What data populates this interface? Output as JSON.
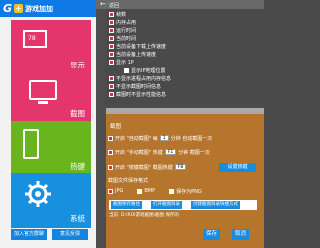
{
  "app": {
    "logo_letter": "G",
    "logo_plus": "+",
    "title": "游戏加加"
  },
  "tiles": [
    {
      "label": "显示",
      "icon": "display-icon",
      "icon_text": "78"
    },
    {
      "label": "截图",
      "icon": "monitor-icon"
    },
    {
      "label": "热键",
      "icon": "keyboard-icon"
    },
    {
      "label": "系统",
      "icon": "gear-icon"
    }
  ],
  "left_buttons": {
    "qq": "加入官方群聊",
    "feedback": "意见反馈"
  },
  "header": {
    "back_glyph": "←",
    "back_label": "返回"
  },
  "display_options": [
    {
      "label": "帧数",
      "checked": true
    },
    {
      "label": "内存占用",
      "checked": true
    },
    {
      "label": "运行时间",
      "checked": true
    },
    {
      "label": "当前时间",
      "checked": true
    },
    {
      "label": "当前设备下载上传速度",
      "checked": true
    },
    {
      "label": "当前设备上传速度",
      "checked": true
    },
    {
      "label": "显示 1P",
      "checked": true
    },
    {
      "label": "显示IP地理位置",
      "checked": false
    },
    {
      "label": "不显示进程占用内存信息",
      "checked": true
    },
    {
      "label": "不显示截图时间信息",
      "checked": true
    },
    {
      "label": "截图时不显示性能信息",
      "checked": true
    }
  ],
  "screenshot": {
    "title": "截图",
    "row1": {
      "prefix": "开启 \"自动截图\" 每",
      "value": "1",
      "suffix": "分钟 自动截图一次"
    },
    "row2": {
      "prefix": "开启 \"手动截图\" 热键",
      "value": "F1",
      "suffix": "分钟 截图一次"
    },
    "row3": {
      "prefix": "开启 \"按键截图\" 截图热键",
      "value": "F8"
    },
    "set_button": "设置热键",
    "folder_label": "截图文件保存格式",
    "formats": [
      {
        "label": "JPG",
        "checked": true
      },
      {
        "label": "BMP",
        "checked": false
      },
      {
        "label": "保存为PNG",
        "checked": false
      }
    ],
    "path_items": [
      "截图保存路径",
      "打开截图目录",
      "创建截图目录快捷方式"
    ],
    "note": "当前: D:\\ROI游戏截图\\截图 保存的"
  },
  "footer": {
    "save": "保存",
    "cancel": "取消"
  }
}
